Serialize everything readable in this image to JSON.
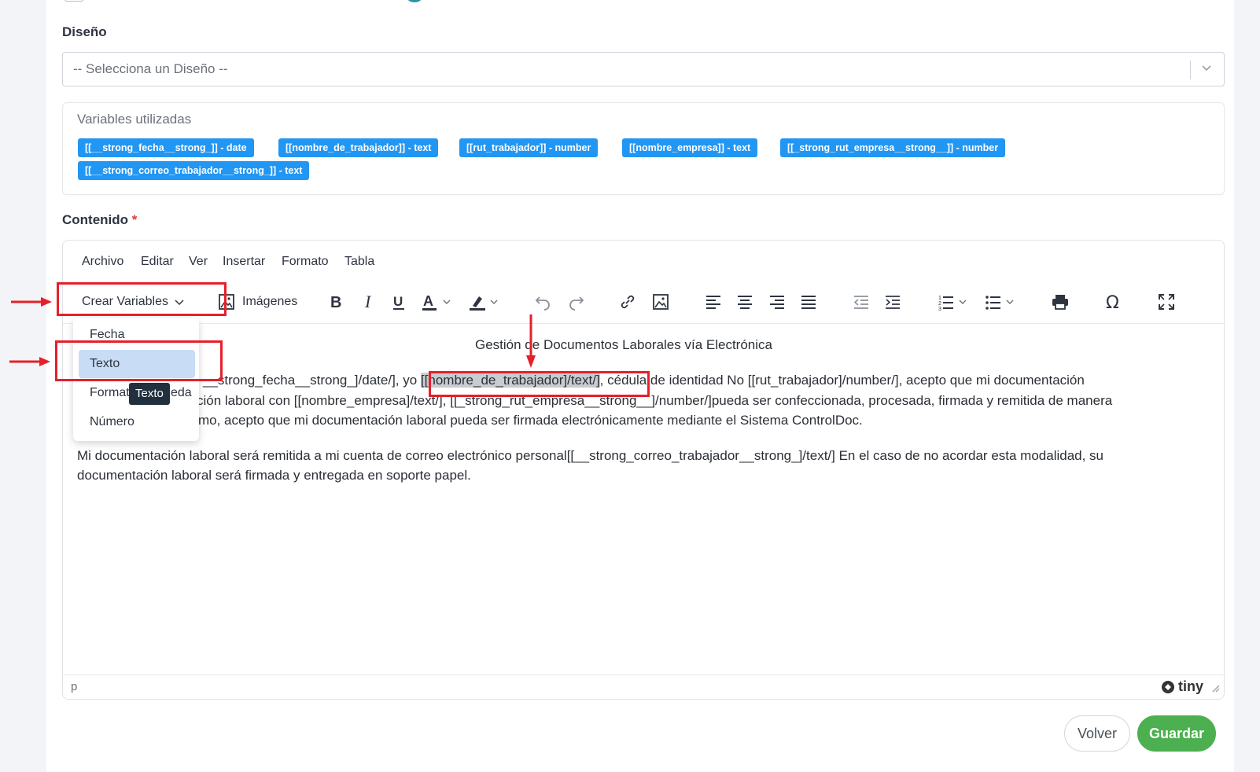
{
  "form": {
    "design_label": "Diseño",
    "design_placeholder": "-- Selecciona un Diseño --",
    "variables_title": "Variables utilizadas",
    "variables": [
      "[[__strong_fecha__strong_]] - date",
      "[[nombre_de_trabajador]] - text",
      "[[rut_trabajador]] - number",
      "[[nombre_empresa]] - text",
      "[[_strong_rut_empresa__strong__]] - number",
      "[[__strong_correo_trabajador__strong_]] - text"
    ],
    "content_label": "Contenido",
    "required_mark": "*"
  },
  "editor": {
    "menu": [
      "Archivo",
      "Editar",
      "Ver",
      "Insertar",
      "Formato",
      "Tabla"
    ],
    "toolbar": {
      "create_variables": "Crear Variables",
      "images": "Imágenes"
    },
    "dropdown": {
      "items": [
        "Fecha",
        "Texto",
        "Formato fecha",
        "Número"
      ],
      "item_3_visible_prefix": "Format",
      "item_3_visible_suffix": "eda",
      "active_index": 1
    },
    "tooltip": "Texto",
    "content": {
      "title": "Gestión de Documentos Laborales vía Electrónica",
      "line1_a": "__strong_fecha__strong_]/date/], yo ",
      "line1_highlight": "[[nombre_de_trabajador]/text/]",
      "line1_b": ", cédula de identidad No [[rut_trabajador]/number/], acepto que mi documentación",
      "line2": "ción laboral con [[nombre_empresa]/text/], [[_strong_rut_empresa__strong__]/number/]pueda ser confeccionada, procesada, firmada y remitida de manera",
      "line3": "mo, acepto que mi documentación laboral pueda ser firmada electrónicamente mediante el Sistema ControlDoc.",
      "para2_line1": "Mi documentación laboral será remitida a mi cuenta de correo electrónico personal[[__strong_correo_trabajador__strong_]/text/] En el caso de no acordar esta modalidad, su",
      "para2_line2": "documentación laboral será firmada y entregada en soporte papel."
    },
    "status_path": "p",
    "brand": "tiny"
  },
  "actions": {
    "back": "Volver",
    "save": "Guardar"
  },
  "colors": {
    "chip": "#2196f3",
    "save": "#4caf50",
    "annotation": "#e5202a",
    "dropdown_active": "#c8dcf5"
  }
}
